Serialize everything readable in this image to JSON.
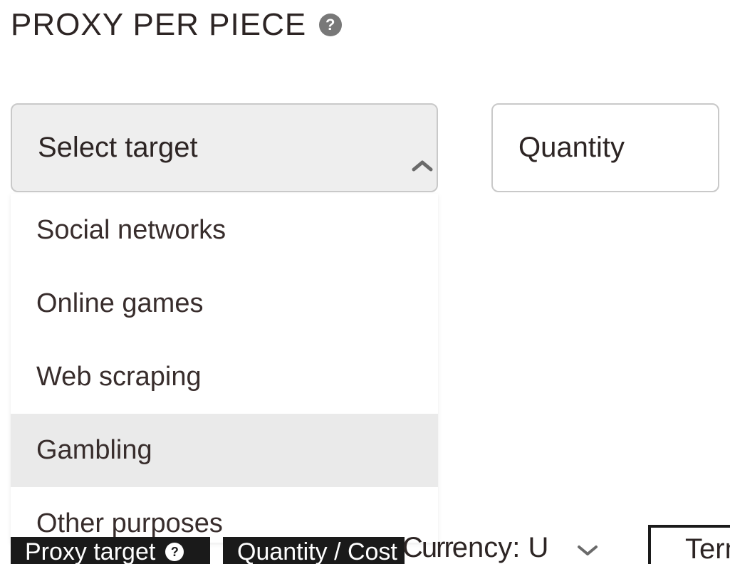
{
  "header": {
    "title": "PROXY PER PIECE"
  },
  "form": {
    "select_target": {
      "label": "Select target",
      "options": [
        "Social networks",
        "Online games",
        "Web scraping",
        "Gambling",
        "Other purposes"
      ],
      "hovered_index": 3
    },
    "quantity": {
      "placeholder": "Quantity"
    }
  },
  "bottom": {
    "proxy_target": "Proxy target",
    "quantity_cost": "Quantity / Cost",
    "currency_label": "ency: U",
    "term_label": "Term"
  }
}
